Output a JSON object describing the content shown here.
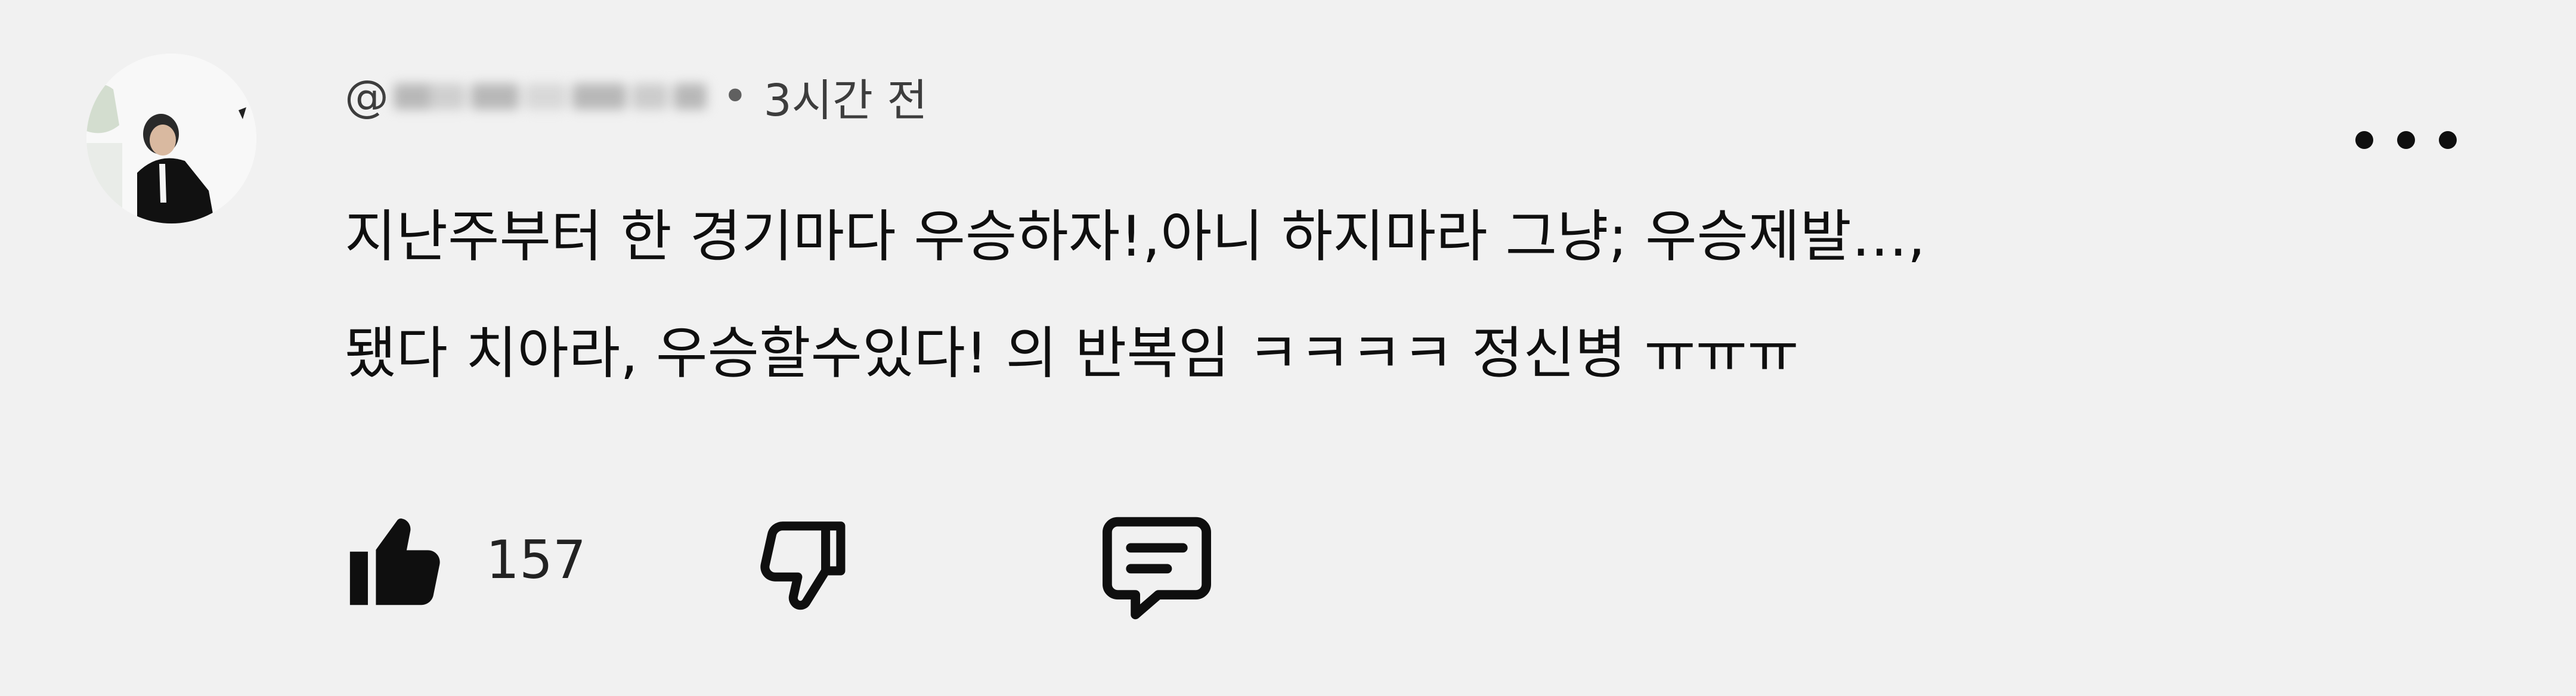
{
  "comment": {
    "author_prefix": "@",
    "time": "3시간 전",
    "text_lines": [
      "지난주부터 한 경기마다 우승하자!,아니 하지마라 그냥; 우승제발…,",
      "됐다 치아라, 우승할수있다! 의 반복임 ㅋㅋㅋㅋ 정신병 ㅠㅠㅠ"
    ],
    "like_count": "157"
  },
  "icons": {
    "avatar": "user-photo",
    "more": "more-options-icon",
    "like": "thumbs-up-filled-icon",
    "dislike": "thumbs-down-outline-icon",
    "reply": "comment-reply-icon"
  },
  "colors": {
    "background": "#f1f1f1",
    "text": "#0f0f0f",
    "meta": "#3d3d3d"
  }
}
